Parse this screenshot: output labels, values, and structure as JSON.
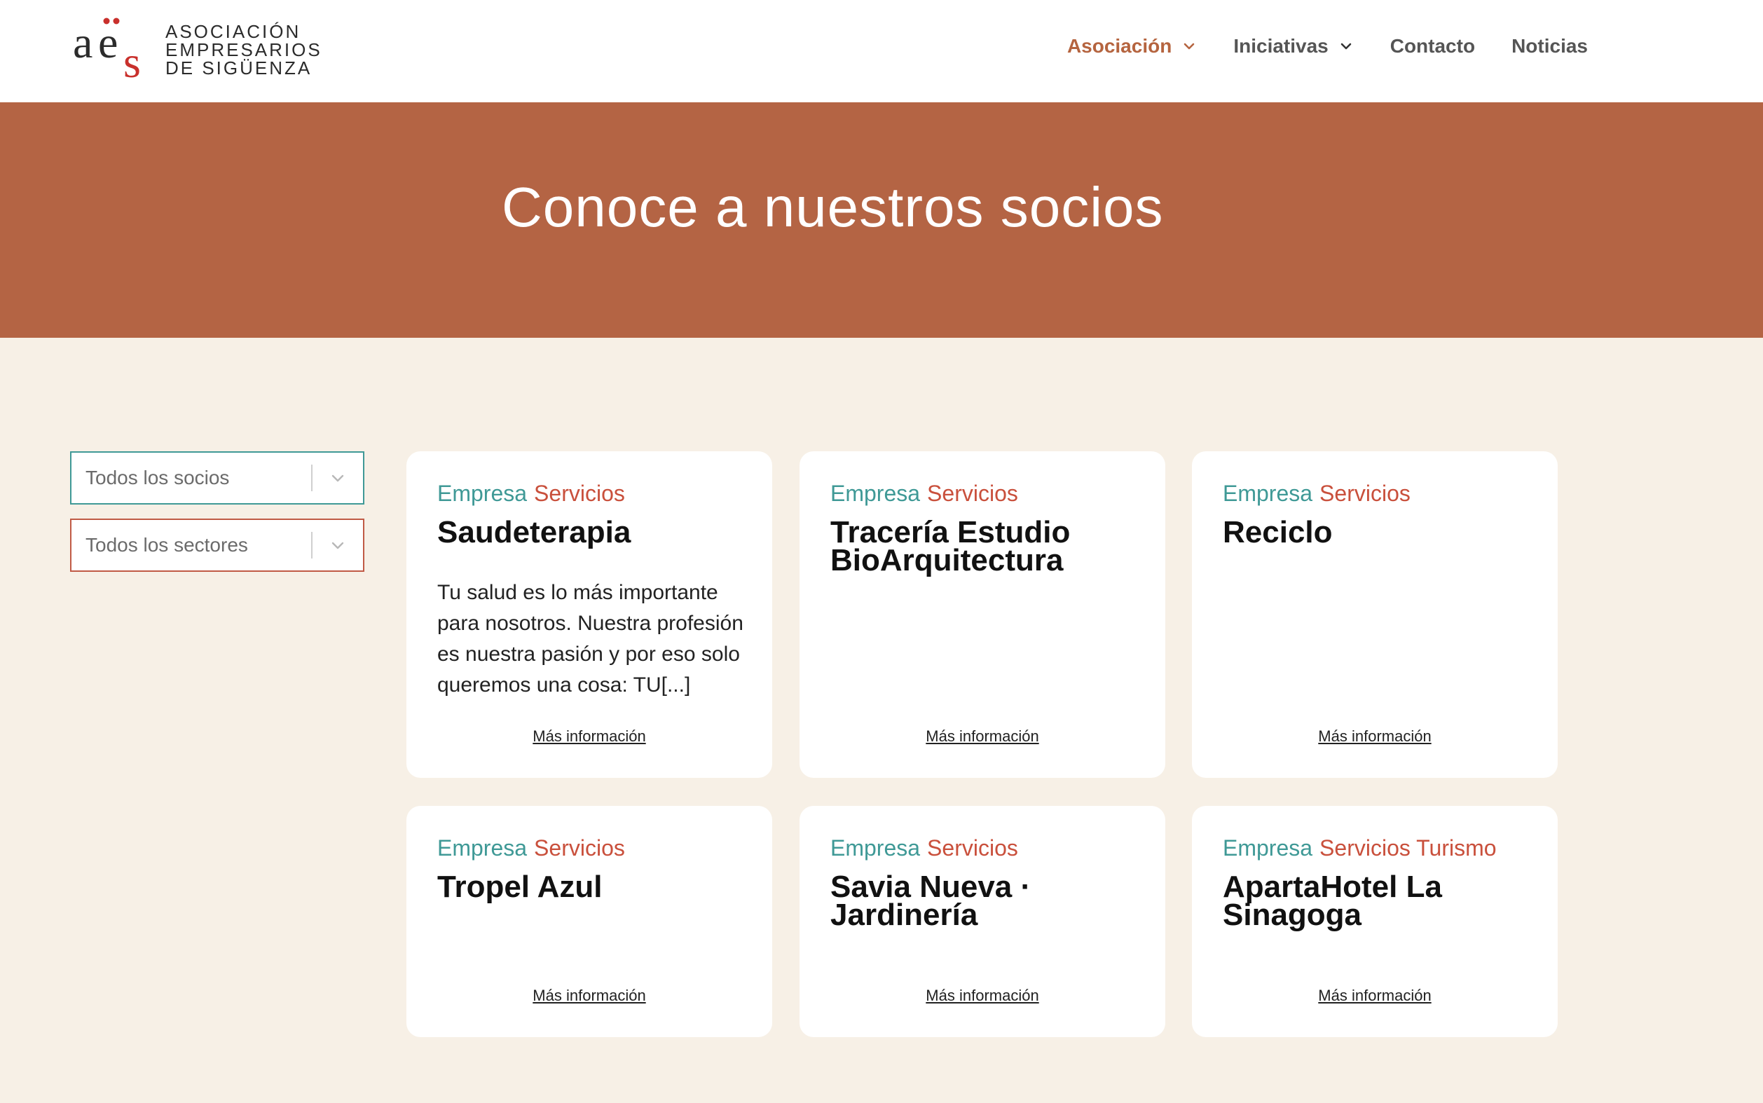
{
  "header": {
    "logo_lines": [
      "ASOCIACIÓN",
      "EMPRESARIOS",
      "DE SIGÜENZA"
    ],
    "nav": [
      {
        "label": "Asociación",
        "dropdown": true,
        "active": true
      },
      {
        "label": "Iniciativas",
        "dropdown": true,
        "active": false
      },
      {
        "label": "Contacto",
        "dropdown": false,
        "active": false
      },
      {
        "label": "Noticias",
        "dropdown": false,
        "active": false
      }
    ]
  },
  "hero": {
    "title": "Conoce a nuestros socios"
  },
  "filters": {
    "socios": "Todos los socios",
    "sectores": "Todos los sectores"
  },
  "cards": [
    {
      "tag1": "Empresa",
      "tag2": "Servicios",
      "title": "Saudeterapia",
      "desc": "Tu salud es lo más importante para nosotros. Nuestra profesión es nuestra pasión y por eso solo queremos una cosa: TU[...]",
      "link": "Más información"
    },
    {
      "tag1": "Empresa",
      "tag2": "Servicios",
      "title": "Tracería Estudio BioArquitectura",
      "desc": "",
      "link": "Más información"
    },
    {
      "tag1": "Empresa",
      "tag2": "Servicios",
      "title": "Reciclo",
      "desc": "",
      "link": "Más información"
    },
    {
      "tag1": "Empresa",
      "tag2": "Servicios",
      "title": "Tropel Azul",
      "desc": "",
      "link": "Más información"
    },
    {
      "tag1": "Empresa",
      "tag2": "Servicios",
      "title": "Savia Nueva · Jardinería",
      "desc": "",
      "link": "Más información"
    },
    {
      "tag1": "Empresa",
      "tag2": "Servicios Turismo",
      "title": "ApartaHotel La Sinagoga",
      "desc": "",
      "link": "Más información"
    }
  ],
  "colors": {
    "accent_rust": "#b46444",
    "teal": "#3f9996",
    "red": "#c9503c",
    "background": "#f7f0e6"
  },
  "icons": {
    "dropdown": "chevron-down-icon",
    "logo": "aes-logo-mark"
  }
}
